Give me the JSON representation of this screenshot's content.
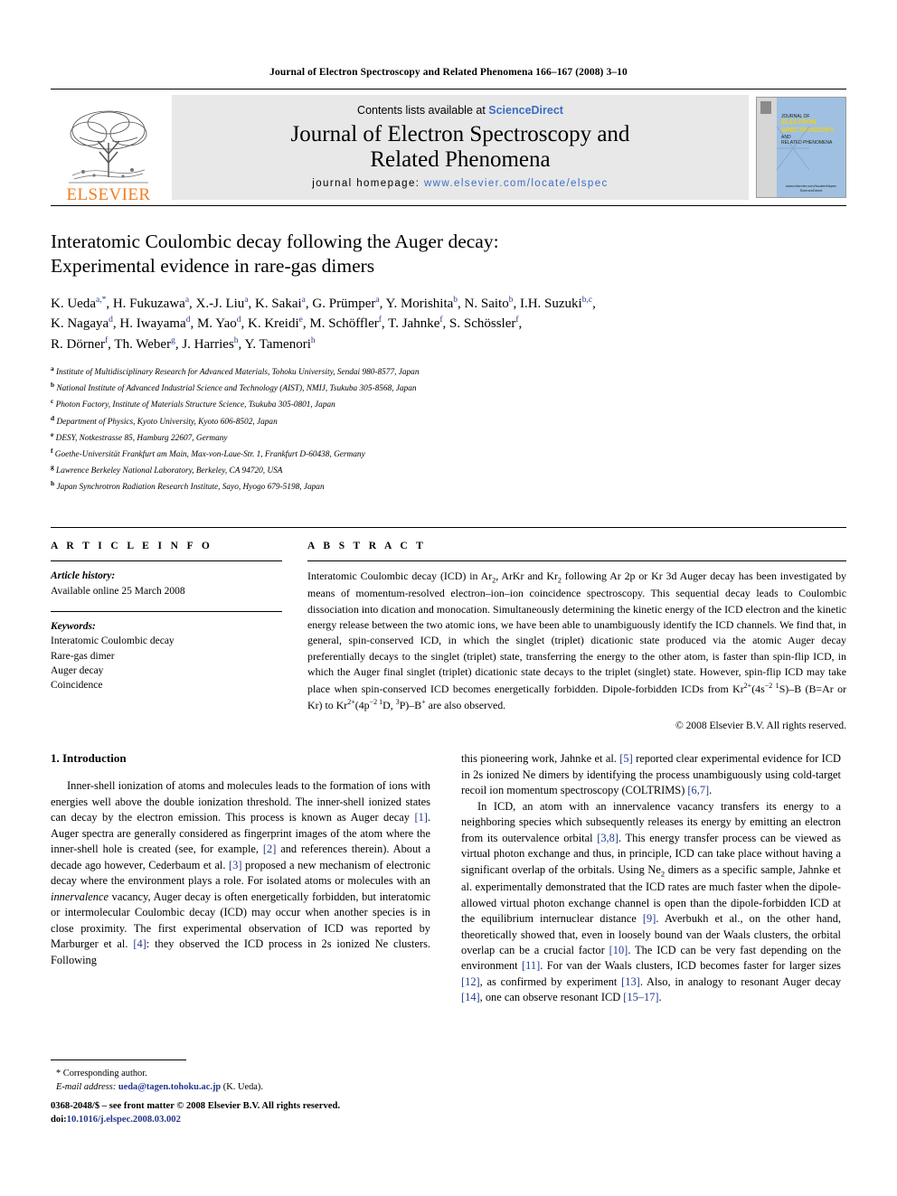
{
  "running_head": "Journal of Electron Spectroscopy and Related Phenomena 166–167 (2008) 3–10",
  "masthead": {
    "publisher_name": "ELSEVIER",
    "publisher_logo_name": "elsevier-tree-logo",
    "contents_prefix": "Contents lists available at ",
    "contents_link": "ScienceDirect",
    "journal_title_line1": "Journal of Electron Spectroscopy and",
    "journal_title_line2": "Related Phenomena",
    "homepage_label": "journal homepage:",
    "homepage_url": "www.elsevier.com/locate/elspec",
    "cover": {
      "line1": "JOURNAL OF",
      "line2": "ELECTRON",
      "line3": "SPECTROSCOPY",
      "line4": "AND",
      "line5": "RELATED PHENOMENA",
      "footer1": "www.elsevier.com/locate/elspec",
      "footer2": "ScienceDirect"
    }
  },
  "article": {
    "title_line1": "Interatomic Coulombic decay following the Auger decay:",
    "title_line2": "Experimental evidence in rare-gas dimers",
    "authors_html": "K. Ueda<sup>a,*</sup>, H. Fukuzawa<sup>a</sup>, X.-J. Liu<sup>a</sup>, K. Sakai<sup>a</sup>, G. Prümper<sup>a</sup>, Y. Morishita<sup>b</sup>, N. Saito<sup>b</sup>, I.H. Suzuki<sup>b,c</sup>,<br>K. Nagaya<sup>d</sup>, H. Iwayama<sup>d</sup>, M. Yao<sup>d</sup>, K. Kreidi<sup>e</sup>, M. Schöffler<sup>f</sup>, T. Jahnke<sup>f</sup>, S. Schössler<sup>f</sup>,<br>R. Dörner<sup>f</sup>, Th. Weber<sup>g</sup>, J. Harries<sup>h</sup>, Y. Tamenori<sup>h</sup>",
    "affiliations": [
      {
        "mark": "a",
        "text": "Institute of Multidisciplinary Research for Advanced Materials, Tohoku University, Sendai 980-8577, Japan"
      },
      {
        "mark": "b",
        "text": "National Institute of Advanced Industrial Science and Technology (AIST), NMIJ, Tsukuba 305-8568, Japan"
      },
      {
        "mark": "c",
        "text": "Photon Factory, Institute of Materials Structure Science, Tsukuba 305-0801, Japan"
      },
      {
        "mark": "d",
        "text": "Department of Physics, Kyoto University, Kyoto 606-8502, Japan"
      },
      {
        "mark": "e",
        "text": "DESY, Notkestrasse 85, Hamburg 22607, Germany"
      },
      {
        "mark": "f",
        "text": "Goethe-Universität Frankfurt am Main, Max-von-Laue-Str. 1, Frankfurt D-60438, Germany"
      },
      {
        "mark": "g",
        "text": "Lawrence Berkeley National Laboratory, Berkeley, CA 94720, USA"
      },
      {
        "mark": "h",
        "text": "Japan Synchrotron Radiation Research Institute, Sayo, Hyogo 679-5198, Japan"
      }
    ]
  },
  "article_info": {
    "heading": "A R T I C L E   I N F O",
    "history_label": "Article history:",
    "history_value": "Available online 25 March 2008",
    "keywords_label": "Keywords:",
    "keywords": [
      "Interatomic Coulombic decay",
      "Rare-gas dimer",
      "Auger decay",
      "Coincidence"
    ]
  },
  "abstract": {
    "heading": "A B S T R A C T",
    "body_html": "Interatomic Coulombic decay (ICD) in Ar<sub>2</sub>, ArKr and Kr<sub>2</sub> following Ar 2p or Kr 3d Auger decay has been investigated by means of momentum-resolved electron–ion–ion coincidence spectroscopy. This sequential decay leads to Coulombic dissociation into dication and monocation. Simultaneously determining the kinetic energy of the ICD electron and the kinetic energy release between the two atomic ions, we have been able to unambiguously identify the ICD channels. We find that, in general, spin-conserved ICD, in which the singlet (triplet) dicationic state produced via the atomic Auger decay preferentially decays to the singlet (triplet) state, transferring the energy to the other atom, is faster than spin-flip ICD, in which the Auger final singlet (triplet) dicationic state decays to the triplet (singlet) state. However, spin-flip ICD may take place when spin-conserved ICD becomes energetically forbidden. Dipole-forbidden ICDs from Kr<sup>2+</sup>(4s<sup>−2 1</sup>S)–B (B&#61;Ar or Kr) to Kr<sup>2+</sup>(4p<sup>−2 1</sup>D, <sup>3</sup>P)–B<sup>+</sup> are also observed.",
    "copyright": "© 2008 Elsevier B.V. All rights reserved."
  },
  "introduction": {
    "heading": "1.  Introduction",
    "left_paragraphs_html": [
      "Inner-shell ionization of atoms and molecules leads to the formation of ions with energies well above the double ionization threshold. The inner-shell ionized states can decay by the electron emission. This process is known as Auger decay <span class=\"ref\">[1]</span>. Auger spectra are generally considered as fingerprint images of the atom where the inner-shell hole is created (see, for example, <span class=\"ref\">[2]</span> and references therein). About a decade ago however, Cederbaum et al. <span class=\"ref\">[3]</span> proposed a new mechanism of electronic decay where the environment plays a role. For isolated atoms or molecules with an <i>innervalence</i> vacancy, Auger decay is often energetically forbidden, but interatomic or intermolecular Coulombic decay (ICD) may occur when another species is in close proximity. The first experimental observation of ICD was reported by Marburger et al. <span class=\"ref\">[4]</span>: they observed the ICD process in 2s ionized Ne clusters. Following"
    ],
    "right_paragraphs_html": [
      "this pioneering work, Jahnke et al. <span class=\"ref\">[5]</span> reported clear experimental evidence for ICD in 2s ionized Ne dimers by identifying the process unambiguously using cold-target recoil ion momentum spectroscopy (COLTRIMS) <span class=\"ref\">[6,7]</span>.",
      "In ICD, an atom with an innervalence vacancy transfers its energy to a neighboring species which subsequently releases its energy by emitting an electron from its outervalence orbital <span class=\"ref\">[3,8]</span>. This energy transfer process can be viewed as virtual photon exchange and thus, in principle, ICD can take place without having a significant overlap of the orbitals. Using Ne<sub>2</sub> dimers as a specific sample, Jahnke et al. experimentally demonstrated that the ICD rates are much faster when the dipole-allowed virtual photon exchange channel is open than the dipole-forbidden ICD at the equilibrium internuclear distance <span class=\"ref\">[9]</span>. Averbukh et al., on the other hand, theoretically showed that, even in loosely bound van der Waals clusters, the orbital overlap can be a crucial factor <span class=\"ref\">[10]</span>. The ICD can be very fast depending on the environment <span class=\"ref\">[11]</span>. For van der Waals clusters, ICD becomes faster for larger sizes <span class=\"ref\">[12]</span>, as confirmed by experiment <span class=\"ref\">[13]</span>. Also, in analogy to resonant Auger decay <span class=\"ref\">[14]</span>, one can observe resonant ICD <span class=\"ref\">[15–17]</span>."
    ]
  },
  "footnotes": {
    "corresponding": "*   Corresponding author.",
    "email_label": "E-mail address:",
    "email": "ueda@tagen.tohoku.ac.jp",
    "email_suffix": " (K. Ueda)."
  },
  "page_footer": {
    "issn_line": "0368-2048/$ – see front matter © 2008 Elsevier B.V. All rights reserved.",
    "doi_label": "doi:",
    "doi_value": "10.1016/j.elspec.2008.03.002"
  },
  "colors": {
    "link": "#3b6ec4",
    "reference": "#24388c",
    "elsevier_orange": "#ef7d22",
    "band_gray": "#e8e8e8",
    "cover_blue": "#9fc0e0"
  }
}
